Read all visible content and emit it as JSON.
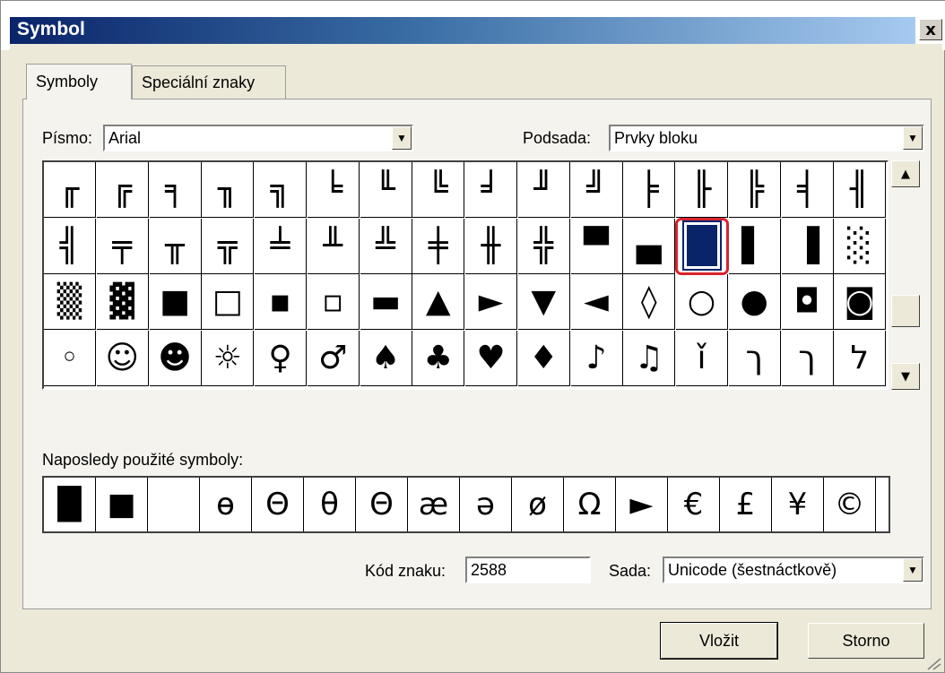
{
  "window": {
    "title": "Symbol",
    "close_label": "x"
  },
  "tabs": [
    {
      "label": "Symboly",
      "active": true
    },
    {
      "label": "Speciální znaky",
      "active": false
    }
  ],
  "font": {
    "label": "Písmo:",
    "value": "Arial"
  },
  "subset": {
    "label": "Podsada:",
    "value": "Prvky bloku"
  },
  "symbol_grid": {
    "rows": [
      [
        "╓",
        "╔",
        "╕",
        "╖",
        "╗",
        "╘",
        "╙",
        "╚",
        "╛",
        "╜",
        "╝",
        "╞",
        "╟",
        "╠",
        "╡",
        "╢"
      ],
      [
        "╣",
        "╤",
        "╥",
        "╦",
        "╧",
        "╨",
        "╩",
        "╪",
        "╫",
        "╬",
        "▀",
        "▄",
        "█",
        "▌",
        "▐",
        "░"
      ],
      [
        "▒",
        "▓",
        "■",
        "□",
        "▪",
        "▫",
        "▬",
        "▲",
        "►",
        "▼",
        "◄",
        "◊",
        "○",
        "●",
        "◘",
        "◙"
      ],
      [
        "◦",
        "☺",
        "☻",
        "☼",
        "♀",
        "♂",
        "♠",
        "♣",
        "♥",
        "♦",
        "♪",
        "♫",
        "ǐ",
        "ך",
        "ך",
        "ל"
      ]
    ],
    "selected_row": 1,
    "selected_col": 12
  },
  "recent": {
    "label": "Naposledy použité symboly:",
    "symbols": [
      "█",
      "■",
      " ",
      "ɵ",
      "Θ",
      "θ",
      "Θ",
      "æ",
      "ə",
      "ø",
      "Ω",
      "►",
      "€",
      "£",
      "¥",
      "©"
    ]
  },
  "char_code": {
    "label": "Kód znaku:",
    "value": "2588"
  },
  "charset": {
    "label": "Sada:",
    "value": "Unicode (šestnáctkově)"
  },
  "buttons": {
    "insert": "Vložit",
    "cancel": "Storno"
  }
}
